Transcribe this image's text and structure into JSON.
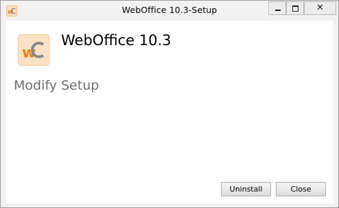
{
  "window": {
    "title": "WebOffice 10.3-Setup",
    "controls": {
      "minimize_icon": "minimize-icon",
      "maximize_icon": "maximize-icon",
      "close_glyph": "✕"
    }
  },
  "product": {
    "name": "WebOffice 10.3",
    "logo_icon": "weboffice-logo-icon"
  },
  "page": {
    "heading": "Modify Setup"
  },
  "buttons": {
    "uninstall": "Uninstall",
    "close": "Close"
  },
  "colors": {
    "logo_background": "#fbe2c6",
    "logo_w": "#e8821d",
    "logo_c": "#8a8a8a",
    "heading_text": "#6e6e6e"
  }
}
